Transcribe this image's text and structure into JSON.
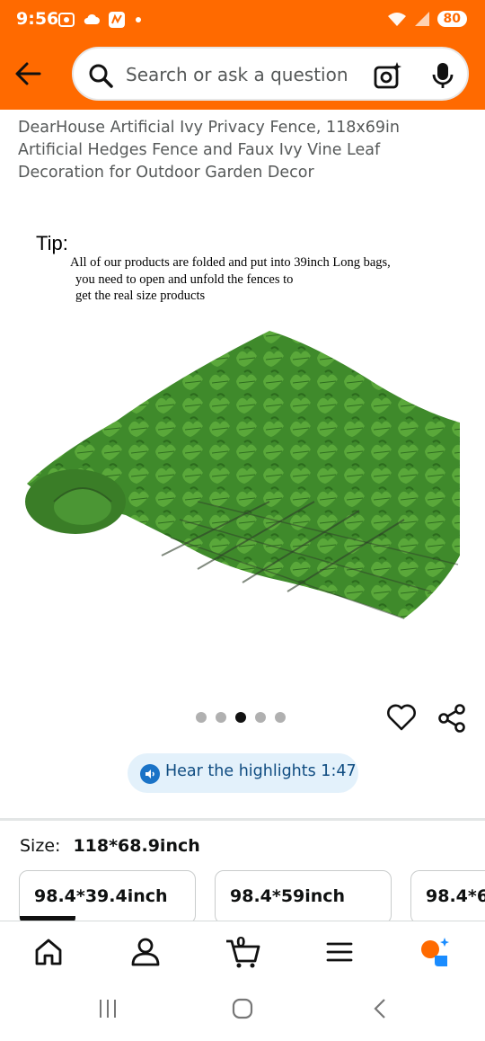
{
  "status_bar": {
    "time": "9:56",
    "battery": "80"
  },
  "search": {
    "placeholder": "Search or ask a question"
  },
  "product": {
    "title": "DearHouse Artificial Ivy Privacy Fence, 118x69in Artificial Hedges Fence and Faux Ivy Vine Leaf Decoration for Outdoor Garden Decor"
  },
  "image": {
    "tip_heading": "Tip:",
    "tip_lines": [
      "All of our products are folded and put into 39inch Long bags,",
      "you need to open and unfold the fences to",
      "get the real size products"
    ],
    "carousel": {
      "count": 5,
      "active_index": 2
    }
  },
  "highlights": {
    "label": "Hear the highlights 1:47"
  },
  "size": {
    "label": "Size:",
    "selected": "118*68.9inch",
    "options": [
      "98.4*39.4inch",
      "98.4*59inch",
      "98.4*6"
    ]
  },
  "bottom_nav": {
    "cart_count": "0"
  },
  "colors": {
    "header": "#ff6a00",
    "highlight_bg": "#e3f1fb",
    "highlight_text": "#0f4c81"
  }
}
